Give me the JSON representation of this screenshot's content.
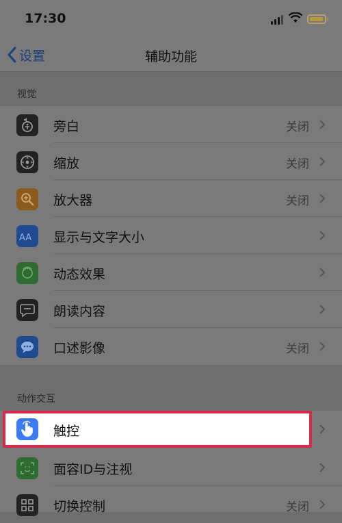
{
  "status": {
    "time": "17:30"
  },
  "nav": {
    "back_label": "设置",
    "title": "辅助功能"
  },
  "sections": {
    "vision_header": "视觉",
    "interaction_header": "动作交互"
  },
  "vision_items": [
    {
      "label": "旁白",
      "value": "关闭",
      "icon": "voiceover-icon"
    },
    {
      "label": "缩放",
      "value": "关闭",
      "icon": "zoom-icon"
    },
    {
      "label": "放大器",
      "value": "关闭",
      "icon": "magnifier-icon"
    },
    {
      "label": "显示与文字大小",
      "value": "",
      "icon": "text-size-icon"
    },
    {
      "label": "动态效果",
      "value": "",
      "icon": "motion-icon"
    },
    {
      "label": "朗读内容",
      "value": "",
      "icon": "spoken-content-icon"
    },
    {
      "label": "口述影像",
      "value": "关闭",
      "icon": "audio-description-icon"
    }
  ],
  "interaction_items": [
    {
      "label": "触控",
      "value": "",
      "icon": "touch-icon"
    },
    {
      "label": "面容ID与注视",
      "value": "",
      "icon": "face-id-icon"
    },
    {
      "label": "切换控制",
      "value": "关闭",
      "icon": "switch-control-icon"
    }
  ],
  "colors": {
    "highlight_border": "#d8294a",
    "touch_icon_bg": "#3b7cf5"
  }
}
